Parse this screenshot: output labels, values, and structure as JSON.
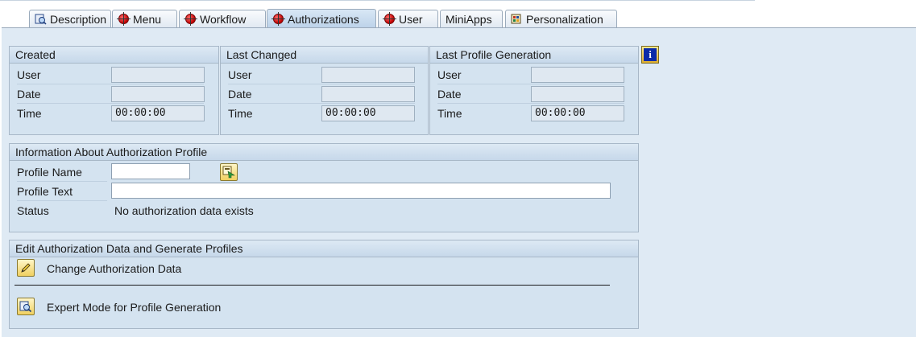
{
  "tabs": [
    {
      "label": "Description",
      "icon": "description-icon"
    },
    {
      "label": "Menu",
      "icon": "inactive-red-icon"
    },
    {
      "label": "Workflow",
      "icon": "inactive-red-icon"
    },
    {
      "label": "Authorizations",
      "icon": "inactive-red-icon"
    },
    {
      "label": "User",
      "icon": "inactive-red-icon"
    },
    {
      "label": "MiniApps",
      "icon": ""
    },
    {
      "label": "Personalization",
      "icon": "personalization-icon"
    }
  ],
  "active_tab": "Authorizations",
  "created": {
    "title": "Created",
    "user_label": "User",
    "date_label": "Date",
    "time_label": "Time",
    "user": "",
    "date": "",
    "time": "00:00:00"
  },
  "last_changed": {
    "title": "Last Changed",
    "user_label": "User",
    "date_label": "Date",
    "time_label": "Time",
    "user": "",
    "date": "",
    "time": "00:00:00"
  },
  "last_profile_generation": {
    "title": "Last Profile Generation",
    "user_label": "User",
    "date_label": "Date",
    "time_label": "Time",
    "user": "",
    "date": "",
    "time": "00:00:00"
  },
  "profile_info": {
    "title": "Information About Authorization Profile",
    "profile_name_label": "Profile Name",
    "profile_name": "",
    "profile_text_label": "Profile Text",
    "profile_text": "",
    "status_label": "Status",
    "status": "No authorization data exists"
  },
  "edit": {
    "title": "Edit Authorization Data and Generate Profiles",
    "change_label": "Change Authorization Data",
    "expert_label": "Expert Mode for Profile Generation"
  },
  "colors": {
    "background": "#dfeaf4",
    "group": "#d4e3f0",
    "header": "#c6d8ea",
    "button": "#f0d060"
  }
}
